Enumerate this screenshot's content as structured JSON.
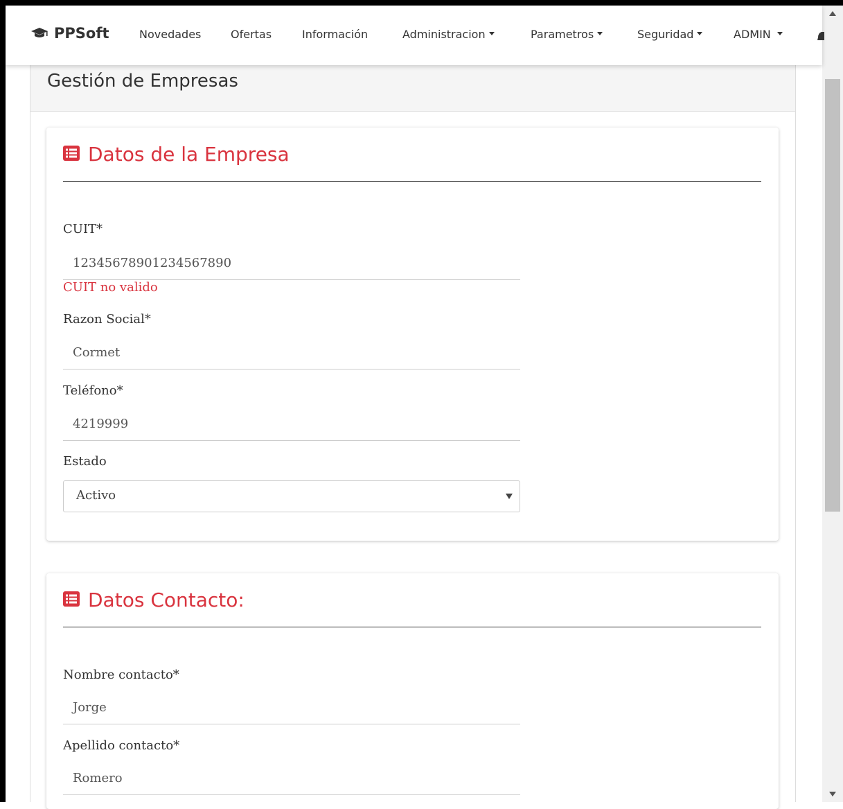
{
  "navbar": {
    "brand": "PPSoft",
    "items": [
      {
        "label": "Novedades",
        "dropdown": false
      },
      {
        "label": "Ofertas",
        "dropdown": false
      },
      {
        "label": "Información",
        "dropdown": false
      },
      {
        "label": "Administracion",
        "dropdown": true
      },
      {
        "label": "Parametros",
        "dropdown": true
      },
      {
        "label": "Seguridad",
        "dropdown": true
      },
      {
        "label": "ADMIN",
        "dropdown": true
      }
    ],
    "icons": [
      "graduation-cap-icon",
      "bell-icon"
    ]
  },
  "page": {
    "title": "Gestión de Empresas"
  },
  "empresa": {
    "title": "Datos de la Empresa",
    "icon": "list-alt-icon",
    "cuit_label": "CUIT*",
    "cuit_value": "12345678901234567890",
    "cuit_error": "CUIT no valido",
    "razon_label": "Razon Social*",
    "razon_value": "Cormet",
    "telefono_label": "Teléfono*",
    "telefono_value": "4219999",
    "estado_label": "Estado",
    "estado_value": "Activo"
  },
  "contacto": {
    "title": "Datos Contacto:",
    "icon": "list-alt-icon",
    "nombre_label": "Nombre contacto*",
    "nombre_value": "Jorge",
    "apellido_label": "Apellido contacto*",
    "apellido_value": "Romero"
  },
  "colors": {
    "accent_red": "#d9343f",
    "heading_bg": "#f5f5f5"
  }
}
